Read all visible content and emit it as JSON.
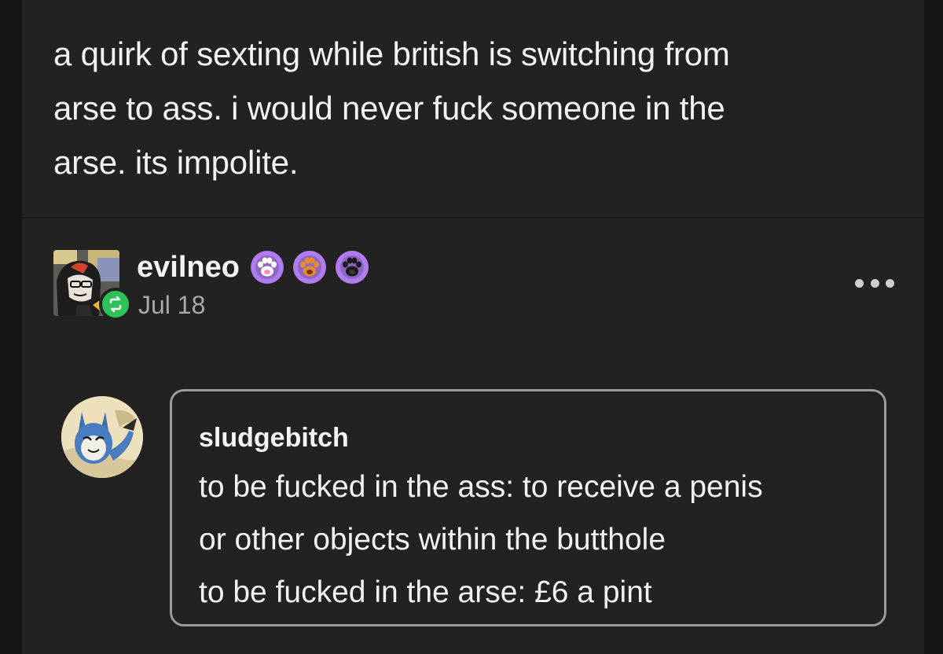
{
  "post": {
    "text_lines": [
      "a quirk of sexting while british is switching from",
      "arse to ass. i would never fuck someone in the",
      "arse. its impolite."
    ]
  },
  "reblog": {
    "username": "evilneo",
    "date": "Jul 18",
    "badges": [
      {
        "icon": "paw-icon",
        "bg": "#b07cf0",
        "paw": "#ffffff",
        "pad": "#f08fbf"
      },
      {
        "icon": "paw-icon",
        "bg": "#b07cf0",
        "paw": "#e98a2a",
        "pad": "#6b3a12"
      },
      {
        "icon": "paw-icon",
        "bg": "#b07cf0",
        "paw": "#1a1a1a",
        "pad": "#3a3a3a"
      }
    ],
    "reblog_badge_color": "#2ec25a"
  },
  "ask": {
    "asker": "sludgebitch",
    "lines": [
      "to be fucked in the ass: to receive a penis",
      "or other objects within the butthole",
      "to be fucked in the arse: £6 a pint"
    ]
  },
  "colors": {
    "background": "#141414",
    "card": "#222222",
    "text": "#f2f2f2",
    "muted": "#a9a9a9"
  }
}
